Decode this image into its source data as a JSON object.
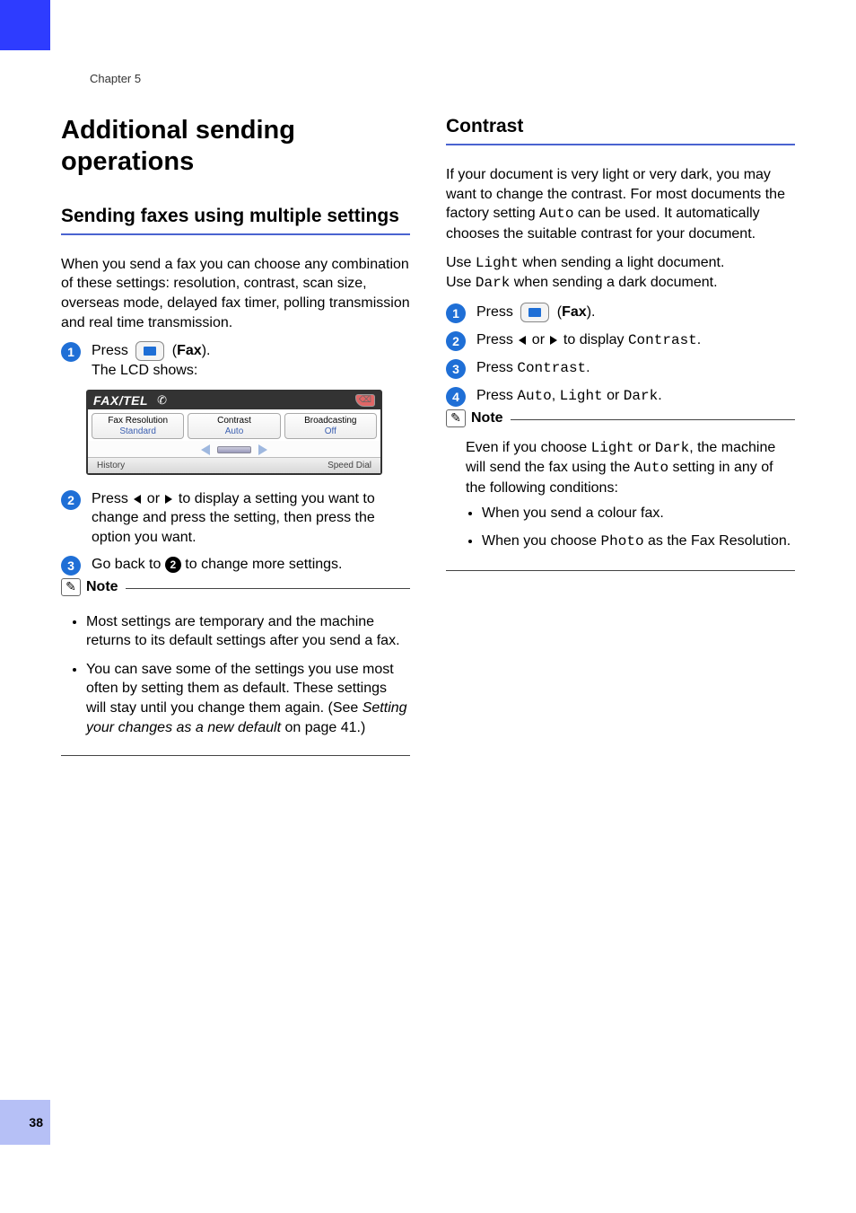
{
  "chapter": "Chapter 5",
  "page_number": "38",
  "left": {
    "h1": "Additional sending operations",
    "h2": "Sending faxes using multiple settings",
    "intro": "When you send a fax you can choose any combination of these settings: resolution, contrast, scan size, overseas mode, delayed fax timer, polling transmission and real time transmission.",
    "step1_a": "Press ",
    "step1_fax": "Fax",
    "step1_b": ").",
    "step1_sub": "The LCD shows:",
    "lcd": {
      "title": "FAX/TEL",
      "tab1": "Fax Resolution",
      "tab1v": "Standard",
      "tab2": "Contrast",
      "tab2v": "Auto",
      "tab3": "Broadcasting",
      "tab3v": "Off",
      "bl": "History",
      "br": "Speed Dial"
    },
    "step2_a": "Press ",
    "step2_b": " or ",
    "step2_c": " to display a setting you want to change and press the setting, then press the option you want.",
    "step3_a": "Go back to ",
    "step3_b": " to change more settings.",
    "step3_ref": "2",
    "note_title": "Note",
    "note_b1": "Most settings are temporary and the machine returns to its default settings after you send a fax.",
    "note_b2_a": "You can save some of the settings you use most often by setting them as default. These settings will stay until you change them again. (See ",
    "note_b2_i": "Setting your changes as a new default",
    "note_b2_b": " on page 41.)"
  },
  "right": {
    "h2": "Contrast",
    "p1_a": "If your document is very light or very dark, you may want to change the contrast. For most documents the factory setting ",
    "p1_auto": "Auto",
    "p1_b": " can be used. It automatically chooses the suitable contrast for your document.",
    "p2_a": "Use ",
    "p2_light": "Light",
    "p2_b": " when sending a light document.",
    "p3_a": "Use ",
    "p3_dark": "Dark",
    "p3_b": " when sending a dark document.",
    "s1_a": "Press ",
    "s1_fax": "Fax",
    "s1_b": ").",
    "s2_a": "Press ",
    "s2_b": " or ",
    "s2_c": " to display ",
    "s2_v": "Contrast",
    "s2_d": ".",
    "s3_a": "Press ",
    "s3_v": "Contrast",
    "s3_b": ".",
    "s4_a": "Press ",
    "s4_v1": "Auto",
    "s4_s1": ", ",
    "s4_v2": "Light",
    "s4_s2": " or ",
    "s4_v3": "Dark",
    "s4_b": ".",
    "note_title": "Note",
    "note_p_a": "Even if you choose ",
    "note_light": "Light",
    "note_p_b": " or ",
    "note_dark": "Dark",
    "note_p_c": ", the machine will send the fax using the ",
    "note_auto": "Auto",
    "note_p_d": " setting in any of the following conditions:",
    "note_li1": "When you send a colour fax.",
    "note_li2_a": "When you choose ",
    "note_li2_v": "Photo",
    "note_li2_b": " as the Fax Resolution."
  }
}
